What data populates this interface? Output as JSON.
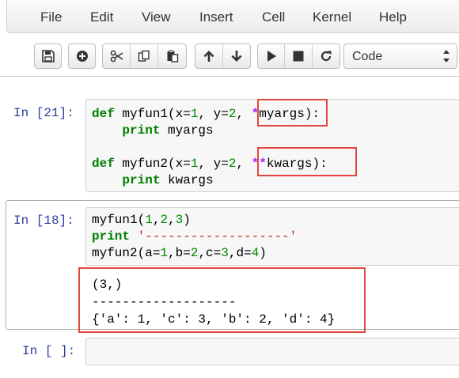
{
  "menubar": {
    "items": [
      "File",
      "Edit",
      "View",
      "Insert",
      "Cell",
      "Kernel",
      "Help"
    ]
  },
  "toolbar": {
    "buttons": [
      {
        "icon": "save-icon"
      },
      {
        "icon": "plus-circle-icon"
      },
      {
        "icon": "scissors-icon"
      },
      {
        "icon": "copy-icon"
      },
      {
        "icon": "paste-icon"
      },
      {
        "icon": "arrow-up-icon"
      },
      {
        "icon": "arrow-down-icon"
      },
      {
        "icon": "play-icon"
      },
      {
        "icon": "stop-icon"
      },
      {
        "icon": "restart-icon"
      }
    ],
    "cell_type": "Code"
  },
  "cells": [
    {
      "prompt": "In [21]:",
      "code_lines": [
        [
          [
            "kw",
            "def"
          ],
          [
            "t",
            " myfun1(x="
          ],
          [
            "num",
            "1"
          ],
          [
            "t",
            ", y="
          ],
          [
            "num",
            "2"
          ],
          [
            "t",
            ", "
          ],
          [
            "op",
            "*"
          ],
          [
            "t",
            "myargs):"
          ]
        ],
        [
          [
            "t",
            "    "
          ],
          [
            "kw",
            "print"
          ],
          [
            "t",
            " myargs"
          ]
        ],
        [
          [
            "t",
            ""
          ]
        ],
        [
          [
            "kw",
            "def"
          ],
          [
            "t",
            " myfun2(x="
          ],
          [
            "num",
            "1"
          ],
          [
            "t",
            ", y="
          ],
          [
            "num",
            "2"
          ],
          [
            "t",
            ", "
          ],
          [
            "op",
            "**"
          ],
          [
            "t",
            "kwargs):"
          ]
        ],
        [
          [
            "t",
            "    "
          ],
          [
            "kw",
            "print"
          ],
          [
            "t",
            " kwargs"
          ]
        ]
      ]
    },
    {
      "prompt": "In [18]:",
      "code_lines": [
        [
          [
            "t",
            "myfun1("
          ],
          [
            "num",
            "1"
          ],
          [
            "t",
            ","
          ],
          [
            "num",
            "2"
          ],
          [
            "t",
            ","
          ],
          [
            "num",
            "3"
          ],
          [
            "t",
            ")"
          ]
        ],
        [
          [
            "kw",
            "print"
          ],
          [
            "t",
            " "
          ],
          [
            "str",
            "'-------------------'"
          ]
        ],
        [
          [
            "t",
            "myfun2(a="
          ],
          [
            "num",
            "1"
          ],
          [
            "t",
            ",b="
          ],
          [
            "num",
            "2"
          ],
          [
            "t",
            ",c="
          ],
          [
            "num",
            "3"
          ],
          [
            "t",
            ",d="
          ],
          [
            "num",
            "4"
          ],
          [
            "t",
            ")"
          ]
        ]
      ],
      "output_lines": [
        "(3,)",
        "-------------------",
        "{'a': 1, 'c': 3, 'b': 2, 'd': 4}"
      ]
    },
    {
      "prompt": "In [ ]:",
      "code_lines": []
    }
  ],
  "colors": {
    "prompt": "#303f9f",
    "keyword": "#008000",
    "number": "#008800",
    "operator": "#aa22ff",
    "string": "#ba2121",
    "highlight": "#e0483f"
  }
}
